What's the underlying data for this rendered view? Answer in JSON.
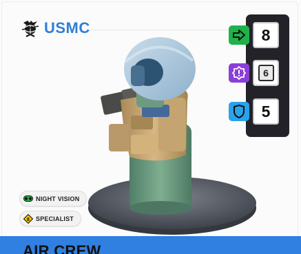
{
  "faction": {
    "name": "USMC",
    "icon": "usmc-emblem-icon",
    "color": "#2f7fd7"
  },
  "stats": [
    {
      "name": "move",
      "icon": "arrow-right-icon",
      "color": "#1fb24a",
      "value": "8",
      "style": "plain"
    },
    {
      "name": "special",
      "icon": "alert-octagon-icon",
      "color": "#8b3fd8",
      "value": "6",
      "style": "boxed"
    },
    {
      "name": "defense",
      "icon": "shield-icon",
      "color": "#2aa3ea",
      "value": "5",
      "style": "plain"
    }
  ],
  "traits": [
    {
      "label": "NIGHT VISION",
      "icon": "night-vision-goggles-icon",
      "color": "#2bb04a"
    },
    {
      "label": "SPECIALIST",
      "icon": "specialist-diamond-icon",
      "color": "#f2c200",
      "badge": "8"
    }
  ],
  "unit": {
    "name": "AIR CREW"
  },
  "figure": {
    "description_icon": "air-crew-miniature"
  },
  "colors": {
    "bottom_bar": "#2f80e0",
    "stat_panel": "#232229"
  }
}
